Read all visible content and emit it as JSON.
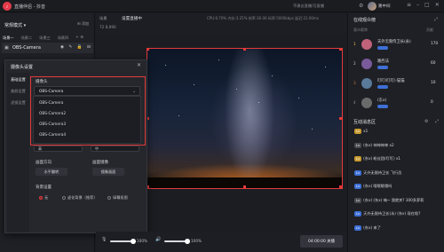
{
  "titlebar": {
    "app_title": "直播伴侣 - 抖音",
    "status_text": "不建议直播/可直播",
    "username": "路中间"
  },
  "left_panel": {
    "scene_title": "常规模式",
    "scene_add": "添加",
    "scene_tabs": [
      "场景一",
      "场景二",
      "场景三",
      "场景四"
    ],
    "source_name": "OBS-Camera"
  },
  "middle_bar": {
    "tag": "场景",
    "title": "设置直播中",
    "stats": "CPU:6.70%  内存:3.25%  帧率:30.00  码率:5000kbps  延迟:21.00ms",
    "sub": "72  8,990"
  },
  "camera_dialog": {
    "title": "摄像头设置",
    "side_items": [
      "基础设置",
      "美颜设置",
      "滤镜设置"
    ],
    "device_label": "摄像头",
    "selected": "OBS-Camera",
    "options": [
      "OBS-Camera",
      "OBS-Camera2",
      "OBS-Camera3",
      "OBS-Camera4"
    ],
    "resolution_left": "高",
    "resolution_right": "中",
    "flip_label": "画面方向",
    "flip_h": "水平翻转",
    "mirror_label": "画面镜像",
    "mirror_btn": "镜像画面",
    "bg_label": "背景设置",
    "bg_options": [
      "无",
      "虚化背景（推荐）",
      "绿幕抠图"
    ]
  },
  "bottom_bar": {
    "mic_volume": "100%",
    "speaker_volume": "100%",
    "mic_level": 1.0,
    "speaker_level": 1.0,
    "live_button": "04:00:00 关播"
  },
  "right_panel": {
    "viewers_title": "在线观众榜",
    "viewers_cols": [
      "观众昵称",
      "贡献"
    ],
    "viewers": [
      {
        "rank": "1",
        "name": "天外无限侍卫长(永)",
        "score": "170",
        "rank_color": "#f1c24a",
        "avatar": "#c0627a"
      },
      {
        "rank": "2",
        "name": "路西法",
        "score": "60",
        "rank_color": "#c0c0c5",
        "avatar": "#7a5a9a"
      },
      {
        "rank": "3",
        "name": "叮叮(叮叮)·猫猫",
        "score": "10",
        "rank_color": "#c97a3a",
        "avatar": "#5a7a9a"
      },
      {
        "rank": "4",
        "name": "(东x)",
        "score": "0",
        "rank_color": "#8a8b92",
        "avatar": "#6a6a6a"
      }
    ],
    "chat_title": "互动消息区",
    "messages": [
      "x1",
      "(东x)  神神神神 x2",
      "(东x)  粉丝团(叮叮) x1",
      "天外无限侍卫长  飞行员",
      "(东x)  哦哦哦哦吗",
      "(东x)  (东x) 嗨~  我就关?  300多萝莉",
      "天外无限侍卫长(永)  (东x)  现在啥?",
      "(东x)  来了"
    ]
  }
}
